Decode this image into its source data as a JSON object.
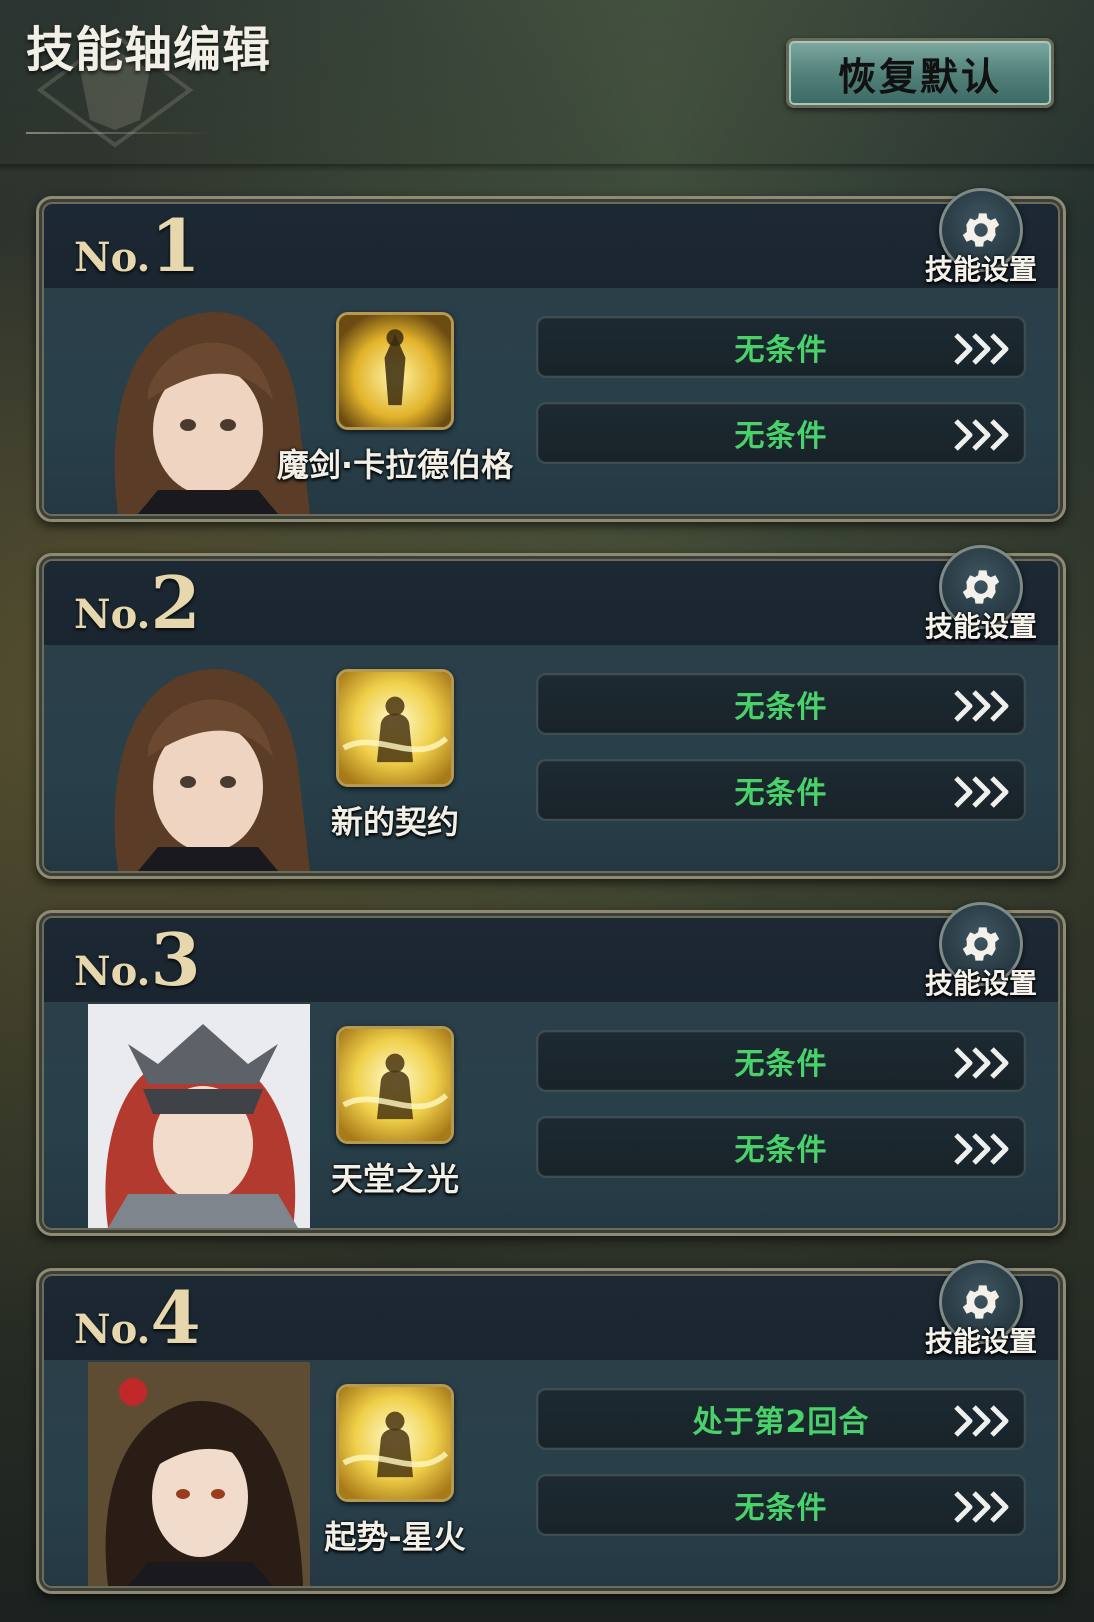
{
  "header": {
    "title": "技能轴编辑",
    "reset_label": "恢复默认"
  },
  "common": {
    "no_prefix": "No.",
    "settings_label": "技能设置"
  },
  "cards": [
    {
      "number": "1",
      "character": "brown-haired-girl",
      "skill_name": "魔剑·卡拉德伯格",
      "conditions": [
        "无条件",
        "无条件"
      ]
    },
    {
      "number": "2",
      "character": "brown-haired-girl",
      "skill_name": "新的契约",
      "conditions": [
        "无条件",
        "无条件"
      ]
    },
    {
      "number": "3",
      "character": "red-haired-knight",
      "skill_name": "天堂之光",
      "conditions": [
        "无条件",
        "无条件"
      ]
    },
    {
      "number": "4",
      "character": "dark-haired-woman",
      "skill_name": "起势-星火",
      "conditions": [
        "处于第2回合",
        "无条件"
      ]
    }
  ],
  "colors": {
    "condition_text": "#49d26a",
    "number_gold": "#e7d7ad"
  }
}
